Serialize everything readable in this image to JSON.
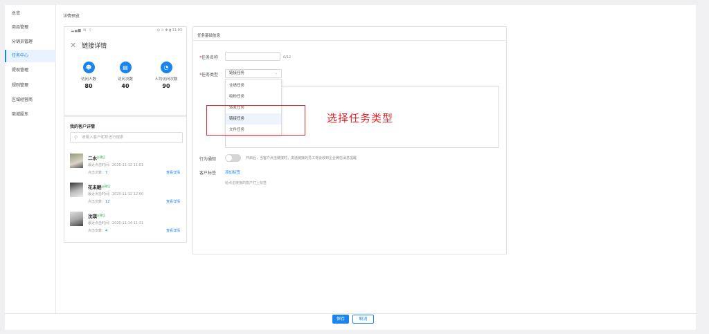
{
  "sidebar": {
    "items": [
      {
        "label": "总览"
      },
      {
        "label": "商品管理"
      },
      {
        "label": "分销员管理"
      },
      {
        "label": "任务中心",
        "active": true
      },
      {
        "label": "提现管理"
      },
      {
        "label": "规则管理"
      },
      {
        "label": "区域经营商"
      },
      {
        "label": "商城股东"
      }
    ]
  },
  "main": {
    "title": "详情预览"
  },
  "phone": {
    "status_left": "▂▄▆ ✉ ⌔",
    "status_right": "⊙ ☼ ✻ ▮ 11:03",
    "close_icon": "✕",
    "title": "链接详情",
    "stats": [
      {
        "icon": "user-icon",
        "glyph": "☻",
        "label": "访问人数",
        "value": "80"
      },
      {
        "icon": "document-icon",
        "glyph": "▤",
        "label": "访问次数",
        "value": "40"
      },
      {
        "icon": "pie-chart-icon",
        "glyph": "◔",
        "label": "人均访问次数",
        "value": "90"
      }
    ],
    "section_title": "我的客户详情",
    "search_placeholder": "请输入客户昵称进行搜索",
    "customers": [
      {
        "name": "二水",
        "tag": "@微信",
        "last_time": "最近点击时间：2020-11-12  11:01",
        "click_label": "点击次数：",
        "clicks": "7",
        "detail": "查看详情"
      },
      {
        "name": "花未眠",
        "tag": "@微信",
        "last_time": "最近点击时间：2020-11-12  12:00",
        "click_label": "点击次数：",
        "clicks": "12",
        "detail": "查看详情"
      },
      {
        "name": "沈琪",
        "tag": "@微信",
        "last_time": "最近点击时间：2020-11-14  11:31",
        "click_label": "点击次数：",
        "clicks": "4",
        "detail": "查看详情"
      }
    ]
  },
  "form": {
    "tab": "任务基础信息",
    "name_label": "任务名称",
    "name_value": "",
    "name_count": "0/12",
    "type_label": "任务类型",
    "type_value": "链接任务",
    "type_options": [
      "业绩任务",
      "吸粉任务",
      "转发任务",
      "链接任务",
      "文件任务"
    ],
    "notify_label": "行为通知",
    "notify_tip": "开启后，当客户点击链接时，发送链接的员工将会收到企业微信消息提醒",
    "tag_label": "客户标签",
    "tag_link": "添加标签",
    "tag_hint": "给点击链接的客户打上标签"
  },
  "annotation": "选择任务类型",
  "footer": {
    "save": "保存",
    "cancel": "取消"
  },
  "colors": {
    "accent": "#1a84f0",
    "annotation": "#e0262a"
  }
}
